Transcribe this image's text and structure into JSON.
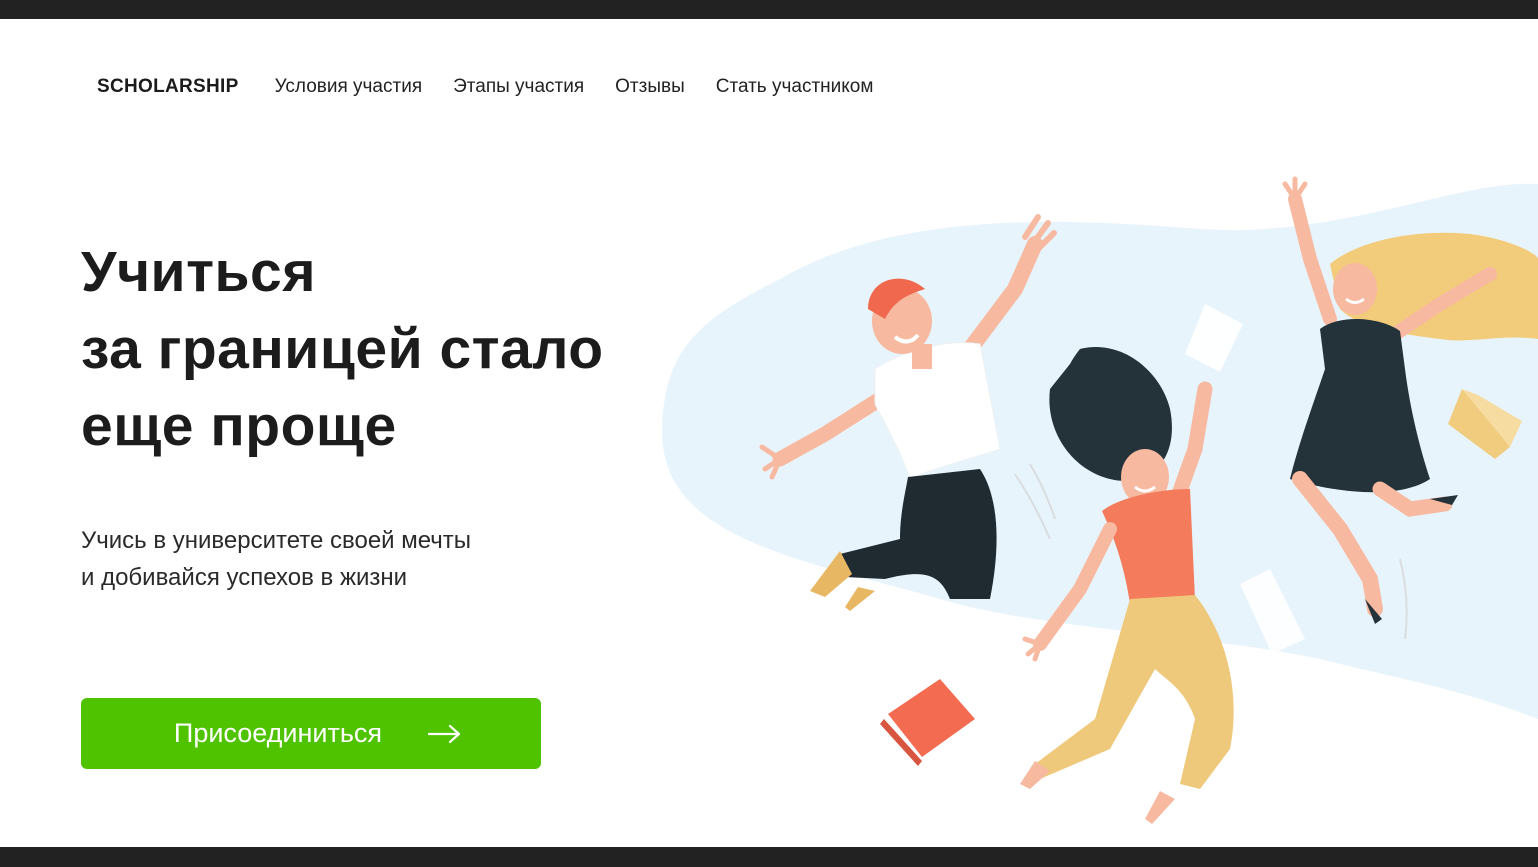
{
  "nav": {
    "logo": "SCHOLARSHIP",
    "items": [
      {
        "label": "Условия участия"
      },
      {
        "label": "Этапы участия"
      },
      {
        "label": "Отзывы"
      },
      {
        "label": "Стать участником"
      }
    ]
  },
  "hero": {
    "title_lines": [
      "Учиться",
      "за границей стало",
      "еще проще"
    ],
    "subtitle_lines": [
      "Учись в университете своей мечты",
      "и добивайся успехов в жизни"
    ],
    "cta_label": "Присоединиться",
    "cta_icon": "arrow-right-icon"
  },
  "illustration": {
    "name": "jumping-students-illustration",
    "colors": {
      "blob": "#e8f4fc",
      "skin": "#f7b9a0",
      "dark": "#243239",
      "orange": "#f47b5c",
      "yellow": "#eec97c",
      "red_hair": "#f0694f",
      "blonde": "#f2cc7b",
      "book_red": "#f36c52",
      "book_yellow": "#f1cc7e"
    }
  },
  "colors": {
    "accent": "#4fc300",
    "text": "#1c1c1c",
    "underline": "#cfe9fb"
  }
}
